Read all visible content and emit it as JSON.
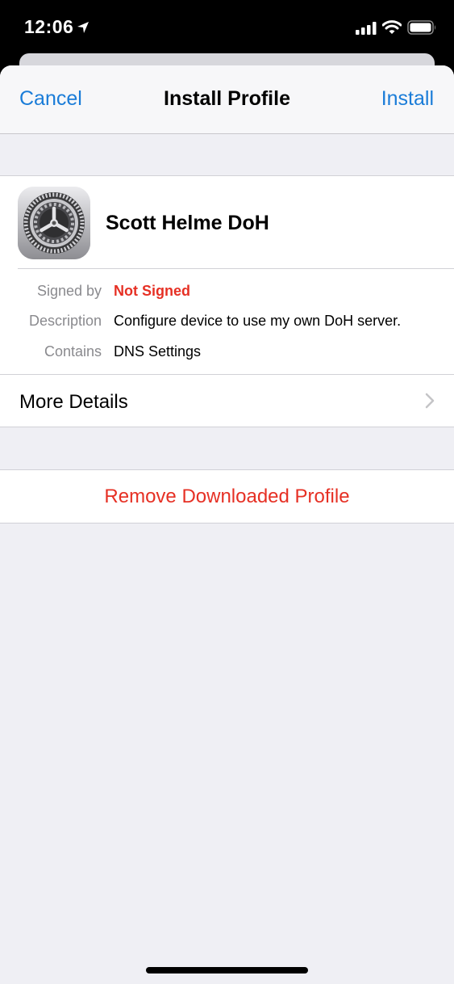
{
  "status_bar": {
    "time": "12:06"
  },
  "nav": {
    "cancel": "Cancel",
    "title": "Install Profile",
    "install": "Install"
  },
  "profile": {
    "name": "Scott Helme DoH",
    "rows": [
      {
        "label": "Signed by",
        "value": "Not Signed"
      },
      {
        "label": "Description",
        "value": "Configure device to use my own DoH server."
      },
      {
        "label": "Contains",
        "value": "DNS Settings"
      }
    ],
    "more_details": "More Details"
  },
  "actions": {
    "remove": "Remove Downloaded Profile"
  },
  "colors": {
    "accent": "#1a7cd8",
    "destructive": "#e63024",
    "background": "#efeff4"
  },
  "icons": [
    "location-arrow-icon",
    "signal-icon",
    "wifi-icon",
    "battery-icon",
    "settings-gear-icon",
    "chevron-right-icon"
  ]
}
